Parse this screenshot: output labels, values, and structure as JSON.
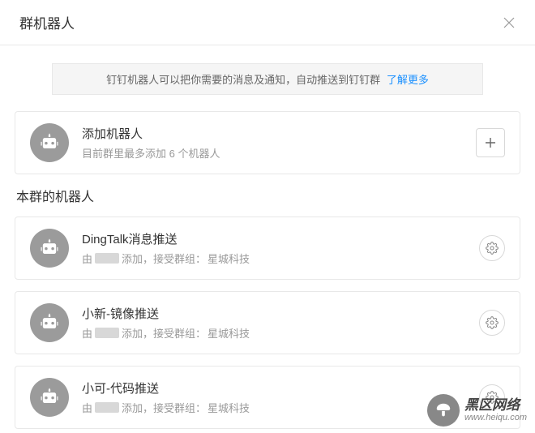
{
  "header": {
    "title": "群机器人"
  },
  "banner": {
    "text": "钉钉机器人可以把你需要的消息及通知，自动推送到钉钉群",
    "link": "了解更多"
  },
  "add": {
    "title": "添加机器人",
    "subtitle": "目前群里最多添加 6 个机器人"
  },
  "section": {
    "title": "本群的机器人"
  },
  "bots": [
    {
      "name": "DingTalk消息推送",
      "by_prefix": "由",
      "by_suffix": "添加，接受群组：",
      "group": "星城科技"
    },
    {
      "name": "小新-镜像推送",
      "by_prefix": "由",
      "by_suffix": "添加，接受群组：",
      "group": "星城科技"
    },
    {
      "name": "小可-代码推送",
      "by_prefix": "由",
      "by_suffix": "添加，接受群组：",
      "group": "星城科技"
    }
  ],
  "watermark": {
    "main": "黑区网络",
    "sub": "www.heiqu.com"
  }
}
